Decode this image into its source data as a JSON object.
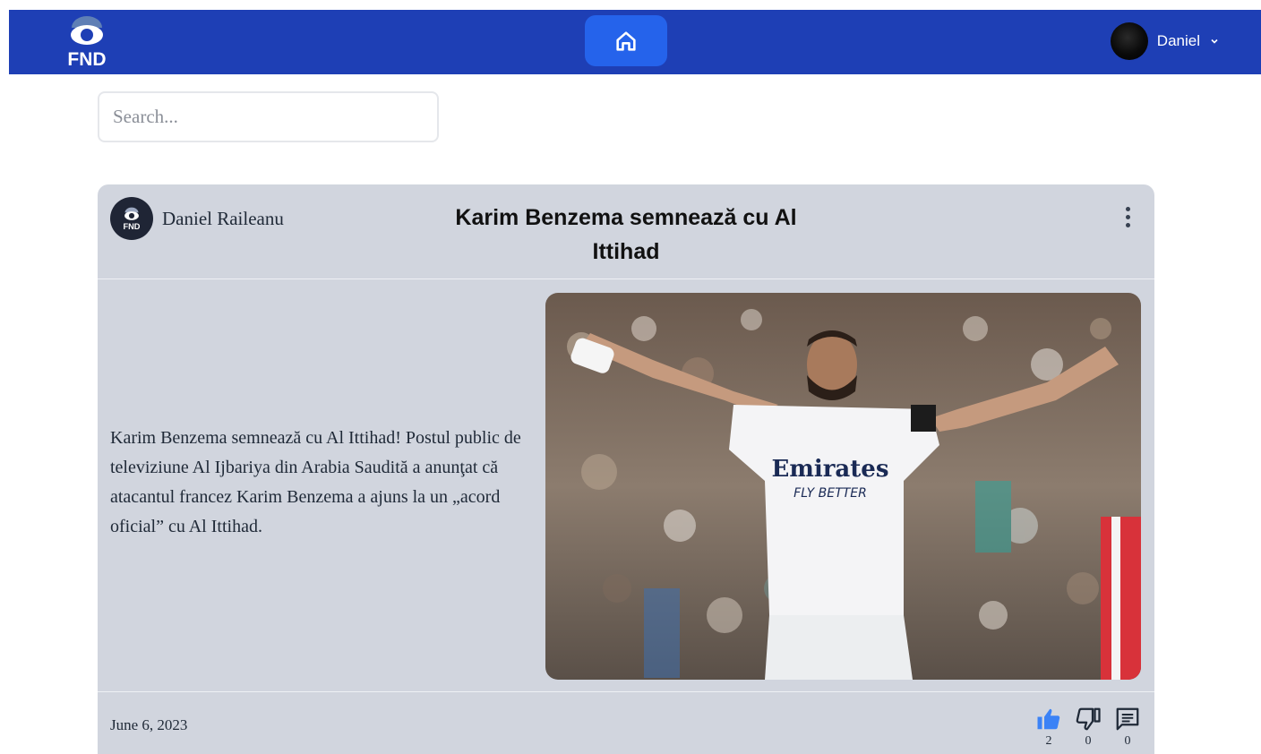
{
  "navbar": {
    "logo_text": "FND",
    "home_icon": "home-icon",
    "user_name": "Daniel",
    "user_menu_icon": "chevron-down-icon",
    "brand_color": "#1e3fb5",
    "accent_color": "#2563eb"
  },
  "search": {
    "placeholder": "Search...",
    "value": ""
  },
  "post": {
    "author_name": "Daniel Raileanu",
    "author_avatar_text": "FND",
    "title": "Karim Benzema semnează cu Al Ittihad",
    "menu_icon": "more-vertical-icon",
    "text": "Karim Benzema semnează cu Al Ittihad! Postul public de televiziune Al Ijbariya din Arabia Saudită a anunţat că atacantul francez Karim Benzema a ajuns la un „acord oficial” cu Al Ittihad.",
    "image_kit_text": "Emirates",
    "image_kit_subtext": "FLY BETTER",
    "date": "June 6, 2023",
    "actions": [
      {
        "icon": "thumbs-up-icon",
        "count": "2",
        "active": true
      },
      {
        "icon": "thumbs-down-icon",
        "count": "0",
        "active": false
      },
      {
        "icon": "comment-icon",
        "count": "0",
        "active": false
      }
    ]
  }
}
